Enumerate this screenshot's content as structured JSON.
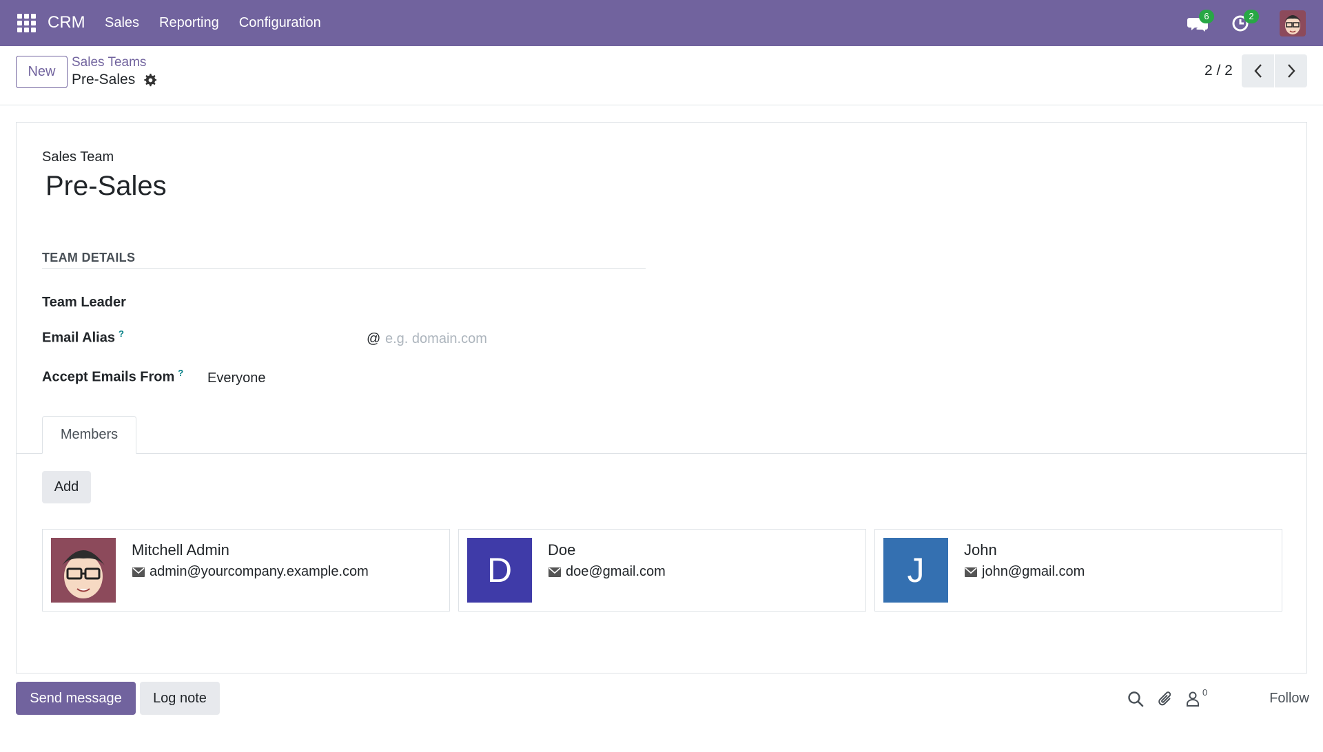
{
  "navbar": {
    "app_name": "CRM",
    "menu": [
      "Sales",
      "Reporting",
      "Configuration"
    ],
    "messages_count": "6",
    "activities_count": "2",
    "icons": [
      "apps-grid-icon",
      "chat-icon",
      "clock-icon",
      "user-avatar"
    ]
  },
  "control_panel": {
    "new_label": "New",
    "breadcrumb_parent": "Sales Teams",
    "breadcrumb_current": "Pre-Sales",
    "pager": "2 / 2"
  },
  "form": {
    "model_label": "Sales Team",
    "record_name": "Pre-Sales",
    "section_title": "TEAM DETAILS",
    "team_leader_label": "Team Leader",
    "email_alias_label": "Email Alias",
    "email_alias_help": "?",
    "alias_at": "@",
    "alias_placeholder": "e.g. domain.com",
    "accept_from_label": "Accept Emails From",
    "accept_from_help": "?",
    "accept_from_value": "Everyone",
    "tab_members": "Members",
    "add_label": "Add"
  },
  "members": [
    {
      "name": "Mitchell Admin",
      "email": "admin@yourcompany.example.com",
      "initial": "",
      "color": "#8c4a5b"
    },
    {
      "name": "Doe",
      "email": "doe@gmail.com",
      "initial": "D",
      "color": "#3f3ba8"
    },
    {
      "name": "John",
      "email": "john@gmail.com",
      "initial": "J",
      "color": "#3470b1"
    }
  ],
  "chatter": {
    "send_message_label": "Send message",
    "log_note_label": "Log note",
    "followers_count": "0",
    "follow_label": "Follow"
  },
  "colors": {
    "brand": "#71639e",
    "badge": "#28a745"
  }
}
